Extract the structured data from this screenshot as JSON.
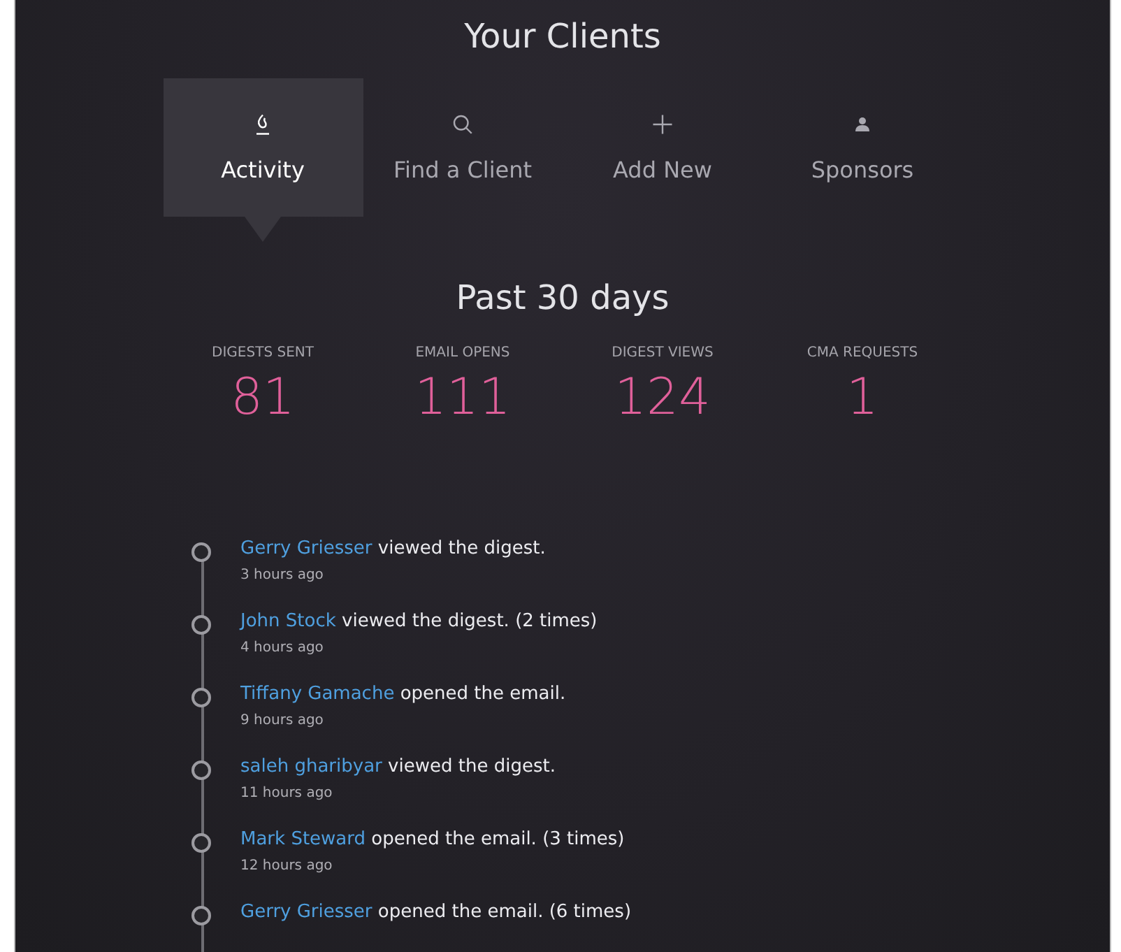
{
  "title": "Your Clients",
  "tabs": [
    {
      "label": "Activity",
      "kind": "activity",
      "selected": true
    },
    {
      "label": "Find a Client",
      "kind": "search",
      "selected": false
    },
    {
      "label": "Add New",
      "kind": "plus",
      "selected": false
    },
    {
      "label": "Sponsors",
      "kind": "person",
      "selected": false
    }
  ],
  "period": "Past 30 days",
  "stats": [
    {
      "label": "DIGESTS SENT",
      "value": "81"
    },
    {
      "label": "EMAIL OPENS",
      "value": "111"
    },
    {
      "label": "DIGEST VIEWS",
      "value": "124"
    },
    {
      "label": "CMA REQUESTS",
      "value": "1"
    }
  ],
  "activity": [
    {
      "name": "Gerry Griesser",
      "action": "viewed the digest.",
      "time": "3 hours ago"
    },
    {
      "name": "John Stock",
      "action": "viewed the digest. (2 times)",
      "time": "4 hours ago"
    },
    {
      "name": "Tiffany Gamache",
      "action": "opened the email.",
      "time": "9 hours ago"
    },
    {
      "name": "saleh gharibyar",
      "action": "viewed the digest.",
      "time": "11 hours ago"
    },
    {
      "name": "Mark Steward",
      "action": "opened the email. (3 times)",
      "time": "12 hours ago"
    },
    {
      "name": "Gerry Griesser",
      "action": "opened the email. (6 times)"
    }
  ]
}
